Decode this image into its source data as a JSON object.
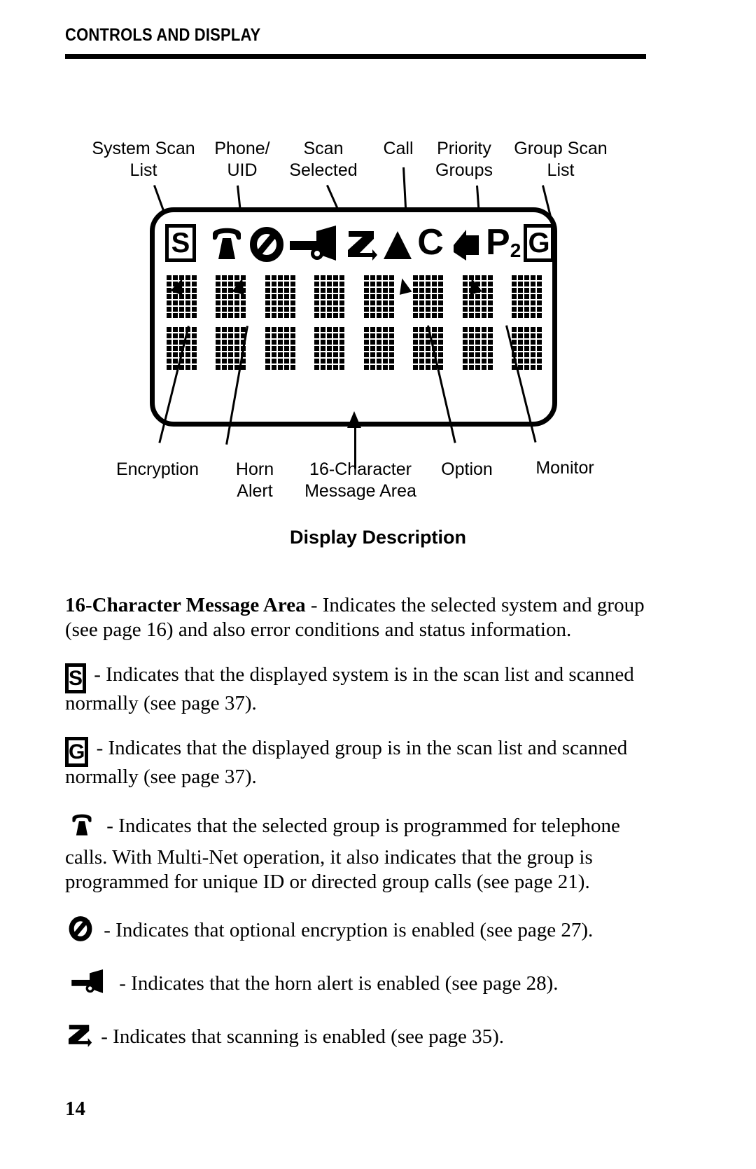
{
  "header": {
    "title": "CONTROLS AND DISPLAY"
  },
  "figure": {
    "caption": "Display Description",
    "top_labels": [
      {
        "name": "system-scan-list",
        "text": "System Scan\nList"
      },
      {
        "name": "phone-uid",
        "text": "Phone/\nUID"
      },
      {
        "name": "scan-selected",
        "text": "Scan\nSelected"
      },
      {
        "name": "call",
        "text": "Call"
      },
      {
        "name": "priority-groups",
        "text": "Priority\nGroups"
      },
      {
        "name": "group-scan-list",
        "text": "Group Scan\nList"
      }
    ],
    "bottom_labels": [
      {
        "name": "encryption",
        "text": "Encryption"
      },
      {
        "name": "horn-alert",
        "text": "Horn\nAlert"
      },
      {
        "name": "message-area",
        "text": "16-Character\nMessage Area"
      },
      {
        "name": "option",
        "text": "Option"
      },
      {
        "name": "monitor",
        "text": "Monitor"
      }
    ],
    "status_icons": [
      {
        "name": "system-scan-list-icon",
        "glyph": "S",
        "kind": "boxed-letter"
      },
      {
        "name": "telephone-icon",
        "glyph": "telephone",
        "kind": "shape"
      },
      {
        "name": "encryption-icon",
        "glyph": "crossed-circle",
        "kind": "shape"
      },
      {
        "name": "horn-alert-icon",
        "glyph": "horn",
        "kind": "shape"
      },
      {
        "name": "scan-icon",
        "glyph": "Z",
        "kind": "letter"
      },
      {
        "name": "option-icon",
        "glyph": "triangle-up",
        "kind": "shape"
      },
      {
        "name": "call-icon",
        "glyph": "C",
        "kind": "letter"
      },
      {
        "name": "monitor-icon",
        "glyph": "speaker-left",
        "kind": "shape"
      },
      {
        "name": "priority-groups-icon",
        "glyph": "P",
        "subscript": "2",
        "kind": "letter"
      },
      {
        "name": "group-scan-list-icon",
        "glyph": "G",
        "kind": "boxed-letter"
      }
    ],
    "message_area": {
      "columns": 8,
      "rows": 2,
      "dot_cols": 5,
      "dot_rows": 7
    }
  },
  "body": {
    "p_message_area": {
      "lead": "16-Character Message Area",
      "text": " - Indicates the selected system and group (see page 16) and also error conditions and status information."
    },
    "p_s": {
      "icon": "S",
      "text": " - Indicates that the displayed system is in the scan list and scanned normally (see page 37)."
    },
    "p_g": {
      "icon": "G",
      "text": " - Indicates that the displayed group is in the scan list and scanned normally (see page 37)."
    },
    "p_phone": {
      "icon": "telephone",
      "text": " - Indicates that the selected group is programmed for telephone calls. With Multi-Net operation, it also indicates that the group is programmed for unique ID or directed group calls (see page 21)."
    },
    "p_encryption": {
      "icon": "crossed-circle",
      "text": " - Indicates that optional encryption is enabled (see page 27)."
    },
    "p_horn": {
      "icon": "horn",
      "text": " - Indicates that the horn alert is enabled (see page 28)."
    },
    "p_scan": {
      "icon": "Z",
      "text": " - Indicates that scanning is enabled (see page 35)."
    }
  },
  "footer": {
    "page_number": "14"
  },
  "colors": {
    "ink": "#000000",
    "paper": "#ffffff"
  }
}
